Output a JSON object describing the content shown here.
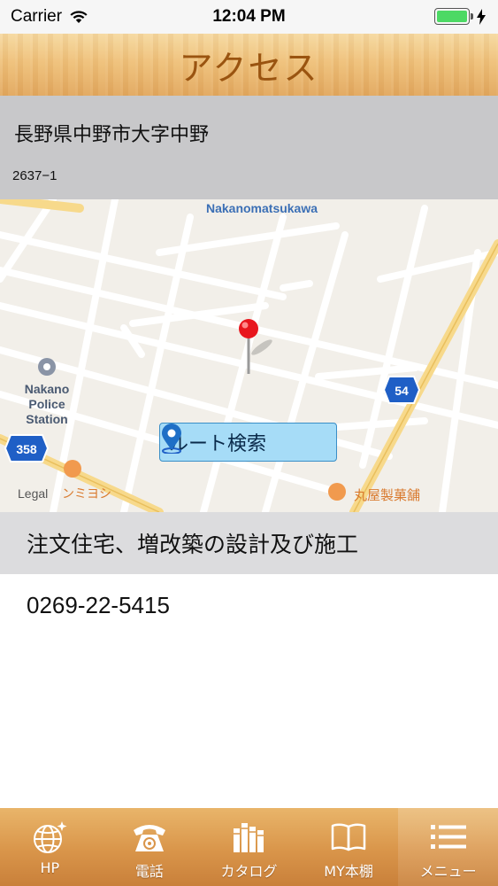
{
  "status_bar": {
    "carrier": "Carrier",
    "time": "12:04 PM"
  },
  "header": {
    "title": "アクセス"
  },
  "address": {
    "line1": "長野県中野市大字中野",
    "line2": "2637−1"
  },
  "map": {
    "labels": {
      "district": "Nakanomatsukawa",
      "police_1": "Nakano",
      "police_2": "Police",
      "police_3": "Station",
      "shop_1": "ンミヨシ",
      "shop_2": "丸屋製菓舗",
      "legal": "Legal",
      "route_358": "358",
      "route_54": "54"
    },
    "route_button": "ルート検索"
  },
  "description": "注文住宅、増改築の設計及び施工",
  "phone": "0269-22-5415",
  "tabs": [
    {
      "label": "HP",
      "icon": "globe-icon"
    },
    {
      "label": "電話",
      "icon": "telephone-icon"
    },
    {
      "label": "カタログ",
      "icon": "catalog-books-icon"
    },
    {
      "label": "MY本棚",
      "icon": "open-book-icon"
    },
    {
      "label": "メニュー",
      "icon": "menu-list-icon"
    }
  ],
  "colors": {
    "accent": "#9a5410",
    "route_button_bg": "#a6dcf7",
    "pin": "#e8161d"
  }
}
